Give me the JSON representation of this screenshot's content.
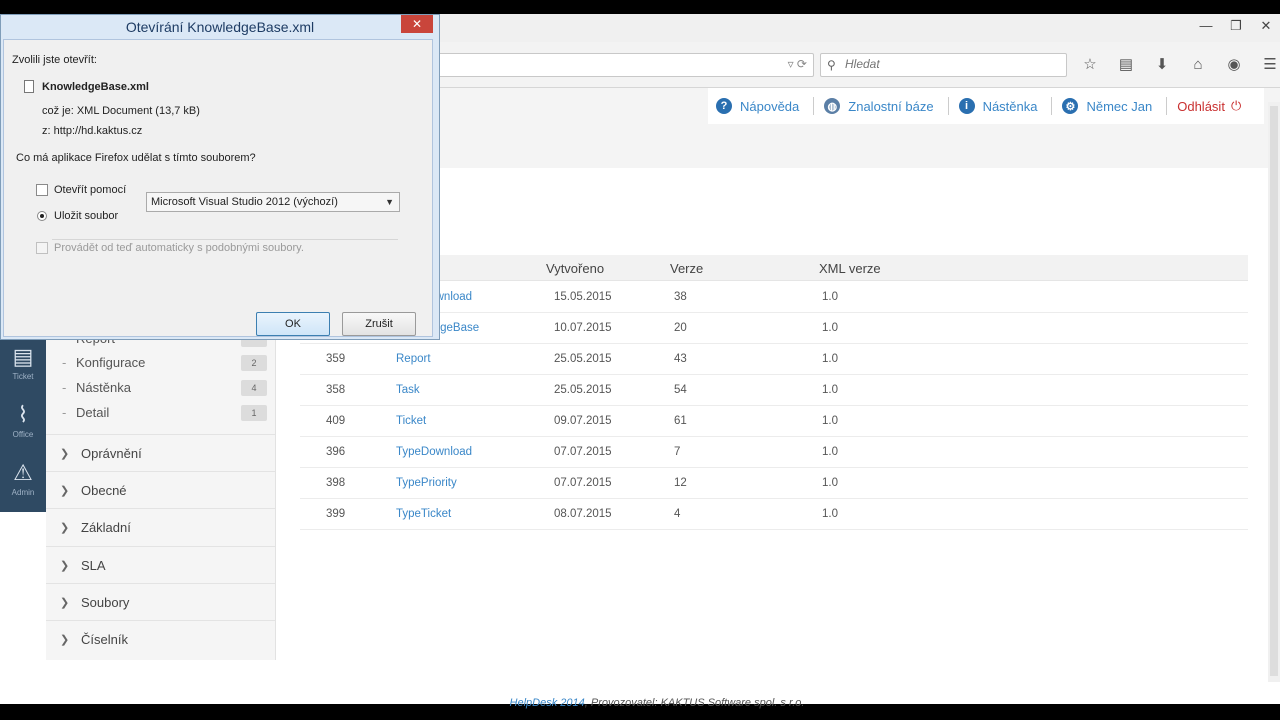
{
  "browser": {
    "search_placeholder": "Hledat",
    "window_buttons": [
      "—",
      "❐",
      "✕"
    ]
  },
  "topnav": {
    "help": "Nápověda",
    "kb": "Znalostní báze",
    "board": "Nástěnka",
    "user": "Němec Jan",
    "logout": "Odhlásit"
  },
  "iconstrip": {
    "items": [
      {
        "icon": "document-icon",
        "label": "Ticket"
      },
      {
        "icon": "chart-icon",
        "label": "Office"
      },
      {
        "icon": "warning-icon",
        "label": "Admin"
      }
    ]
  },
  "sidebar": {
    "partial_item": "Report",
    "subitems": [
      {
        "label": "Konfigurace",
        "count": "2"
      },
      {
        "label": "Nástěnka",
        "count": "4"
      },
      {
        "label": "Detail",
        "count": "1"
      }
    ],
    "sections": [
      "Oprávnění",
      "Obecné",
      "Základní",
      "SLA",
      "Soubory",
      "Číselník"
    ]
  },
  "table": {
    "headers": {
      "created": "Vytvořeno",
      "version": "Verze",
      "xml": "XML verze"
    },
    "rows": [
      {
        "id": "",
        "name": "TypeDownload",
        "created": "15.05.2015",
        "version": "38",
        "xml": "1.0"
      },
      {
        "id": "",
        "name": "KnowledgeBase",
        "created": "10.07.2015",
        "version": "20",
        "xml": "1.0"
      },
      {
        "id": "359",
        "name": "Report",
        "created": "25.05.2015",
        "version": "43",
        "xml": "1.0"
      },
      {
        "id": "358",
        "name": "Task",
        "created": "25.05.2015",
        "version": "54",
        "xml": "1.0"
      },
      {
        "id": "409",
        "name": "Ticket",
        "created": "09.07.2015",
        "version": "61",
        "xml": "1.0"
      },
      {
        "id": "396",
        "name": "TypeDownload",
        "created": "07.07.2015",
        "version": "7",
        "xml": "1.0"
      },
      {
        "id": "398",
        "name": "TypePriority",
        "created": "07.07.2015",
        "version": "12",
        "xml": "1.0"
      },
      {
        "id": "399",
        "name": "TypeTicket",
        "created": "08.07.2015",
        "version": "4",
        "xml": "1.0"
      }
    ]
  },
  "footer": {
    "brand": "HelpDesk 2014",
    "rest": ", Provozovatel: KAKTUS Software spol. s r.o."
  },
  "dialog": {
    "title": "Otevírání KnowledgeBase.xml",
    "intro": "Zvolili jste otevřít:",
    "filename": "KnowledgeBase.xml",
    "type_line": "což je: XML Document (13,7 kB)",
    "from_line": "z:  http://hd.kaktus.cz",
    "question": "Co má aplikace Firefox udělat s tímto souborem?",
    "open_with_label": "Otevřít pomocí",
    "open_with_value": "Microsoft Visual Studio 2012 (výchozí)",
    "save_label": "Uložit soubor",
    "auto_label": "Provádět od teď automaticky s podobnými soubory.",
    "ok": "OK",
    "cancel": "Zrušit"
  }
}
